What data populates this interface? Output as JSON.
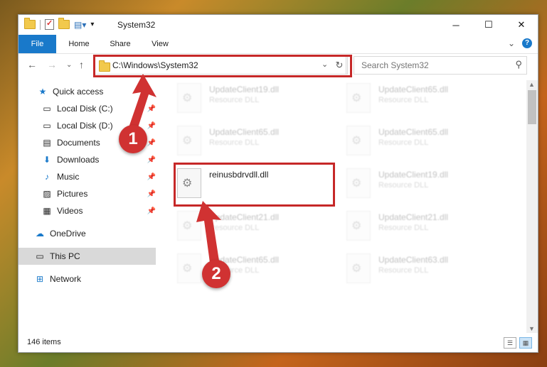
{
  "window": {
    "title": "System32",
    "controls": {
      "minimize": "─",
      "maximize": "☐",
      "close": "✕"
    }
  },
  "ribbon": {
    "tabs": [
      "File",
      "Home",
      "Share",
      "View"
    ],
    "collapse_glyph": "⌄",
    "help_glyph": "?"
  },
  "nav": {
    "back": "←",
    "forward": "→",
    "recent": "⌄",
    "up": "↑",
    "address": "C:\\Windows\\System32",
    "address_dropdown": "⌄",
    "refresh": "↻",
    "search_placeholder": "Search System32",
    "search_glyph": "⚲"
  },
  "sidebar": {
    "items": [
      {
        "label": "Quick access",
        "icon": "star-icon",
        "glyph": "★",
        "color": "#1979ca"
      },
      {
        "label": "Local Disk (C:)",
        "icon": "drive-icon",
        "glyph": "▭",
        "pinned": true
      },
      {
        "label": "Local Disk (D:)",
        "icon": "drive-icon",
        "glyph": "▭",
        "pinned": true
      },
      {
        "label": "Documents",
        "icon": "documents-icon",
        "glyph": "▤",
        "pinned": true
      },
      {
        "label": "Downloads",
        "icon": "downloads-icon",
        "glyph": "⬇",
        "color": "#1979ca",
        "pinned": true
      },
      {
        "label": "Music",
        "icon": "music-icon",
        "glyph": "♪",
        "color": "#1979ca",
        "pinned": true
      },
      {
        "label": "Pictures",
        "icon": "pictures-icon",
        "glyph": "▨",
        "pinned": true
      },
      {
        "label": "Videos",
        "icon": "videos-icon",
        "glyph": "▦",
        "pinned": true
      },
      {
        "label": "OneDrive",
        "icon": "onedrive-icon",
        "glyph": "☁",
        "color": "#1979ca"
      },
      {
        "label": "This PC",
        "icon": "pc-icon",
        "glyph": "▭",
        "selected": true
      },
      {
        "label": "Network",
        "icon": "network-icon",
        "glyph": "⊞",
        "color": "#1979ca"
      }
    ],
    "pin_glyph": "📌"
  },
  "files": [
    {
      "name": "UpdateClient19.dll",
      "type": "Resource DLL",
      "blurred": true
    },
    {
      "name": "UpdateClient65.dll",
      "type": "Resource DLL",
      "blurred": true
    },
    {
      "name": "UpdateClient65.dll",
      "type": "Resource DLL",
      "blurred": true
    },
    {
      "name": "UpdateClient65.dll",
      "type": "Resource DLL",
      "blurred": true
    },
    {
      "name": "reinusbdrvdll.dll",
      "type": "",
      "blurred": false
    },
    {
      "name": "UpdateClient19.dll",
      "type": "Resource DLL",
      "blurred": true
    },
    {
      "name": "UpdateClient21.dll",
      "type": "Resource DLL",
      "blurred": true
    },
    {
      "name": "UpdateClient21.dll",
      "type": "Resource DLL",
      "blurred": true
    },
    {
      "name": "UpdateClient65.dll",
      "type": "Resource DLL",
      "blurred": true
    },
    {
      "name": "UpdateClient63.dll",
      "type": "Resource DLL",
      "blurred": true
    }
  ],
  "status": {
    "count": "146 items"
  },
  "annotations": {
    "step1": "1",
    "step2": "2",
    "color": "#d03232"
  }
}
